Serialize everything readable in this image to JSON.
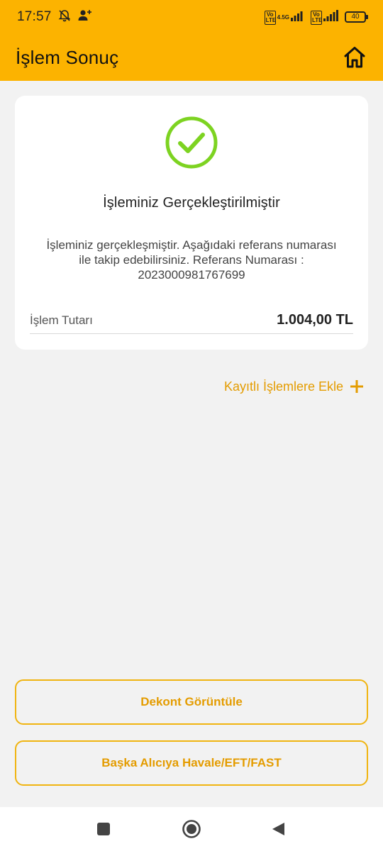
{
  "status_bar": {
    "time": "17:57",
    "left_icons": [
      "bell-off-icon",
      "person-add-icon"
    ],
    "sim1": {
      "volte": "Vo LTE",
      "network": "4.5G"
    },
    "sim2": {
      "volte": "Vo LTE"
    },
    "battery": "40"
  },
  "app_bar": {
    "title": "İşlem Sonuç",
    "home_icon": "home-icon"
  },
  "result_card": {
    "icon": "check-circle-icon",
    "title": "İşleminiz Gerçekleştirilmiştir",
    "description": "İşleminiz gerçekleşmiştir. Aşağıdaki referans numarası ile takip edebilirsiniz. Referans Numarası : 2023000981767699",
    "amount_label": "İşlem Tutarı",
    "amount_value": "1.004,00 TL"
  },
  "save_link": {
    "label": "Kayıtlı İşlemlere Ekle",
    "icon": "plus-icon"
  },
  "buttons": {
    "dekont": "Dekont Görüntüle",
    "other_transfer": "Başka Alıcıya Havale/EFT/FAST"
  },
  "nav_bar": {
    "items": [
      "recents-icon",
      "home-circle-icon",
      "back-icon"
    ]
  },
  "colors": {
    "accent": "#fcb300",
    "accent_text": "#e49c00",
    "success": "#7dd321",
    "background": "#f2f2f2"
  }
}
